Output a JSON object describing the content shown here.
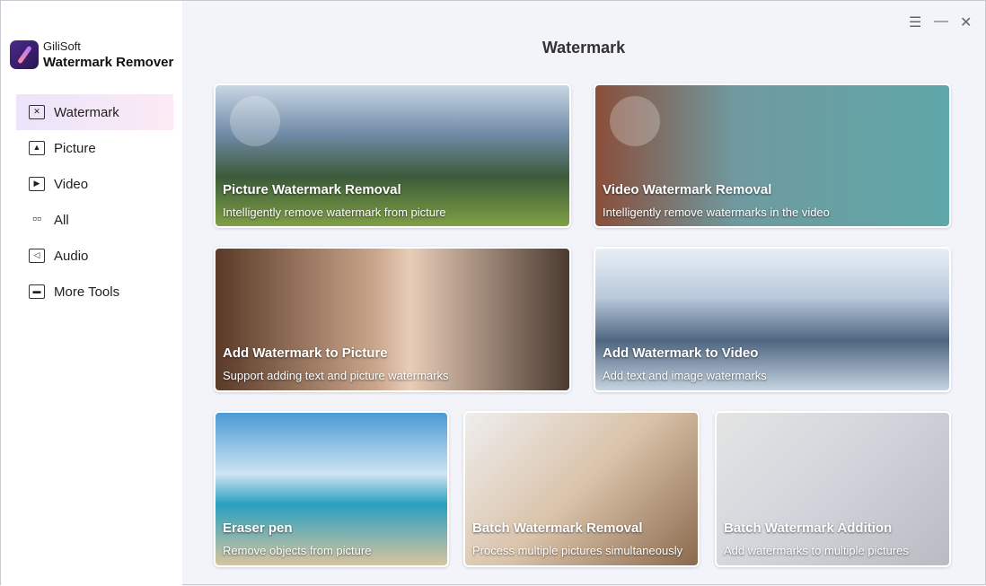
{
  "app": {
    "brand_top": "GiliSoft",
    "brand_name": "Watermark Remover"
  },
  "sidebar": {
    "items": [
      {
        "label": "Watermark",
        "icon": "watermark-icon",
        "active": true
      },
      {
        "label": "Picture",
        "icon": "picture-icon"
      },
      {
        "label": "Video",
        "icon": "video-icon"
      },
      {
        "label": "All",
        "icon": "grid-icon"
      },
      {
        "label": "Audio",
        "icon": "audio-icon"
      },
      {
        "label": "More Tools",
        "icon": "toolbox-icon"
      }
    ]
  },
  "header": {
    "title": "Watermark",
    "menu": "☰",
    "minimize": "—",
    "close": "✕"
  },
  "cards": [
    {
      "title": "Picture Watermark Removal",
      "subtitle": "Intelligently remove watermark from picture"
    },
    {
      "title": "Video Watermark Removal",
      "subtitle": "Intelligently remove watermarks in the video"
    },
    {
      "title": "Add Watermark to Picture",
      "subtitle": "Support adding text and picture watermarks"
    },
    {
      "title": "Add Watermark to Video",
      "subtitle": "Add text and image watermarks"
    },
    {
      "title": "Eraser pen",
      "subtitle": "Remove objects from picture"
    },
    {
      "title": "Batch Watermark Removal",
      "subtitle": "Process multiple pictures simultaneously"
    },
    {
      "title": "Batch Watermark Addition",
      "subtitle": "Add watermarks to multiple pictures"
    }
  ]
}
